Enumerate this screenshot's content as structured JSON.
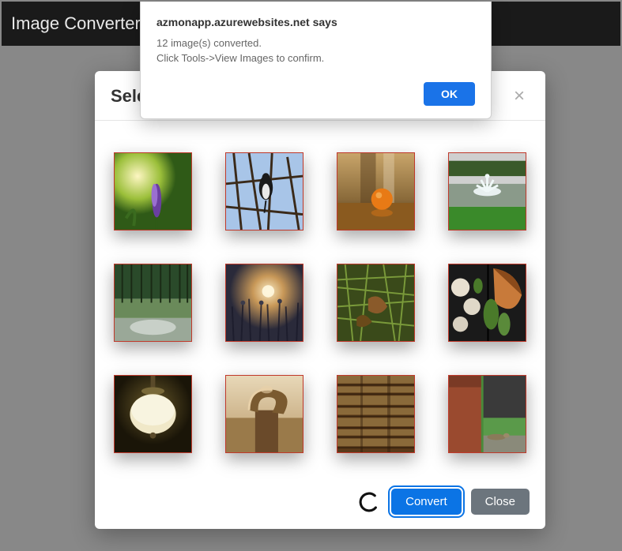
{
  "topbar": {
    "title": "Image Converter"
  },
  "modal": {
    "title": "Sele",
    "close_symbol": "×",
    "thumbnails": [
      {
        "name": "purple-flower"
      },
      {
        "name": "bird-on-branch"
      },
      {
        "name": "orange-on-table"
      },
      {
        "name": "fountain-lawn"
      },
      {
        "name": "forest-stream"
      },
      {
        "name": "sunset-grass"
      },
      {
        "name": "leaves-ground"
      },
      {
        "name": "food-platter"
      },
      {
        "name": "ceiling-lamp"
      },
      {
        "name": "wooden-handle"
      },
      {
        "name": "stacked-wood"
      },
      {
        "name": "lizard-brick"
      }
    ],
    "convert_label": "Convert",
    "close_label": "Close"
  },
  "alert": {
    "title": "azmonapp.azurewebsites.net says",
    "line1": "12 image(s) converted.",
    "line2": "Click Tools->View Images to confirm.",
    "ok_label": "OK"
  }
}
